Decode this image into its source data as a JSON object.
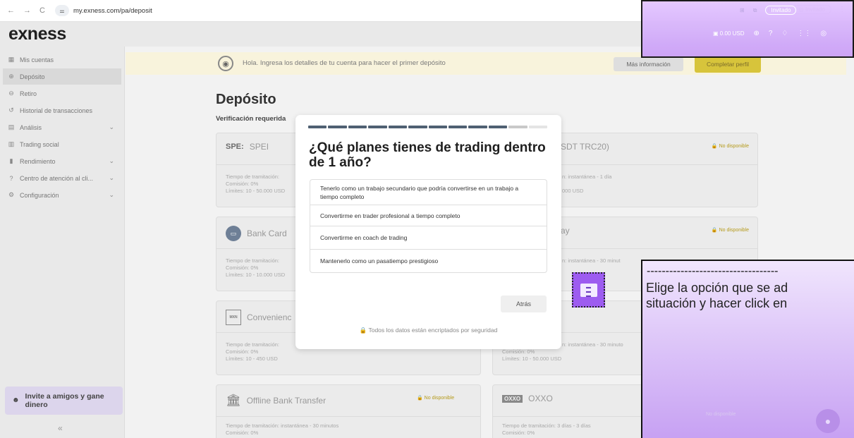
{
  "browser": {
    "url": "my.exness.com/pa/deposit",
    "guest_label": "Invitado"
  },
  "app": {
    "logo": "exness",
    "balance": "0.00 USD"
  },
  "sidebar": {
    "items": [
      {
        "label": "Mis cuentas",
        "icon": "grid-icon",
        "glyph": "▦",
        "has_chevron": false,
        "active": false
      },
      {
        "label": "Depósito",
        "icon": "deposit-icon",
        "glyph": "⊕",
        "has_chevron": false,
        "active": true
      },
      {
        "label": "Retiro",
        "icon": "withdraw-icon",
        "glyph": "⊖",
        "has_chevron": false,
        "active": false
      },
      {
        "label": "Historial de transacciones",
        "icon": "history-icon",
        "glyph": "↺",
        "has_chevron": false,
        "active": false
      },
      {
        "label": "Análisis",
        "icon": "analysis-icon",
        "glyph": "▤",
        "has_chevron": true,
        "active": false
      },
      {
        "label": "Trading social",
        "icon": "social-trading-icon",
        "glyph": "▥",
        "has_chevron": false,
        "active": false
      },
      {
        "label": "Rendimiento",
        "icon": "performance-icon",
        "glyph": "▮",
        "has_chevron": true,
        "active": false
      },
      {
        "label": "Centro de atención al cli...",
        "icon": "help-icon",
        "glyph": "?",
        "has_chevron": true,
        "active": false
      },
      {
        "label": "Configuración",
        "icon": "settings-icon",
        "glyph": "⚙",
        "has_chevron": true,
        "active": false
      }
    ],
    "invite": "Invite a amigos y gane dinero",
    "collapse": "«"
  },
  "banner": {
    "text": "Hola. Ingresa los detalles de tu cuenta para hacer el primer depósito",
    "more_button": "Más información",
    "complete_button": "Completar perfil"
  },
  "page": {
    "title": "Depósito",
    "verification": "Verificación requerida"
  },
  "cards": {
    "spei": {
      "logo": "SPE:",
      "name": "SPEI",
      "time": "Tiempo de tramitación: ",
      "fee": "Comisión: 0%",
      "limits": "Límites: 10 - 50.000 USD"
    },
    "usdt": {
      "name": "SDT TRC20)",
      "status": "No disponible",
      "time": "n: instantánea - 1 día",
      "limits": "000 USD"
    },
    "bank_card": {
      "name": "Bank Card",
      "time": "Tiempo de tramitación: ",
      "fee": "Comisión: 0%",
      "limits": "Límites: 10 - 10.000 USD"
    },
    "pay": {
      "name": "ay",
      "status": "No disponible",
      "time": "n: instantánea - 30 minut"
    },
    "convenience": {
      "name": "Convenienc",
      "icon_text": "MXN",
      "time": "Tiempo de tramitación: ",
      "fee": "Comisión: 0%",
      "limits": "Límites: 10 - 450 USD"
    },
    "store": {
      "time": "n: instantánea - 30 minuto",
      "fee": "Comisión: 0%",
      "limits": "Límites: 10 - 50.000 USD"
    },
    "offline": {
      "name": "Offline Bank Transfer",
      "status": "No disponible",
      "time": "Tiempo de tramitación: instantánea - 30 minutos",
      "fee": "Comisión: 0%"
    },
    "oxxo": {
      "name": "OXXO",
      "logo": "OXXO",
      "time": "Tiempo de tramitación: 3 días - 3 días",
      "fee": "Comisión: 0%"
    },
    "ghost_status": "No disponible"
  },
  "modal": {
    "progress": {
      "filled": 10,
      "total": 12
    },
    "question": "¿Qué planes tienes de trading dentro de 1 año?",
    "options": [
      "Tenerlo como un trabajo secundario que podría convertirse en un trabajo a tiempo completo",
      "Convertirme en trader profesional a tiempo completo",
      "Convertirme en coach de trading",
      "Mantenerlo como un pasatiempo prestigioso"
    ],
    "back_button": "Atrás",
    "security_note": "Todos los datos están encriptados por seguridad"
  },
  "overlay": {
    "dashes": "-----------------------------------",
    "instruction": "Elige la opción que se ad\nsituación y hacer click en"
  },
  "colors": {
    "brand_yellow": "#d7c43b",
    "overlay_purple": "#cba0f7",
    "progress_filled": "#4f6072",
    "progress_empty": "#e4e4e4"
  }
}
